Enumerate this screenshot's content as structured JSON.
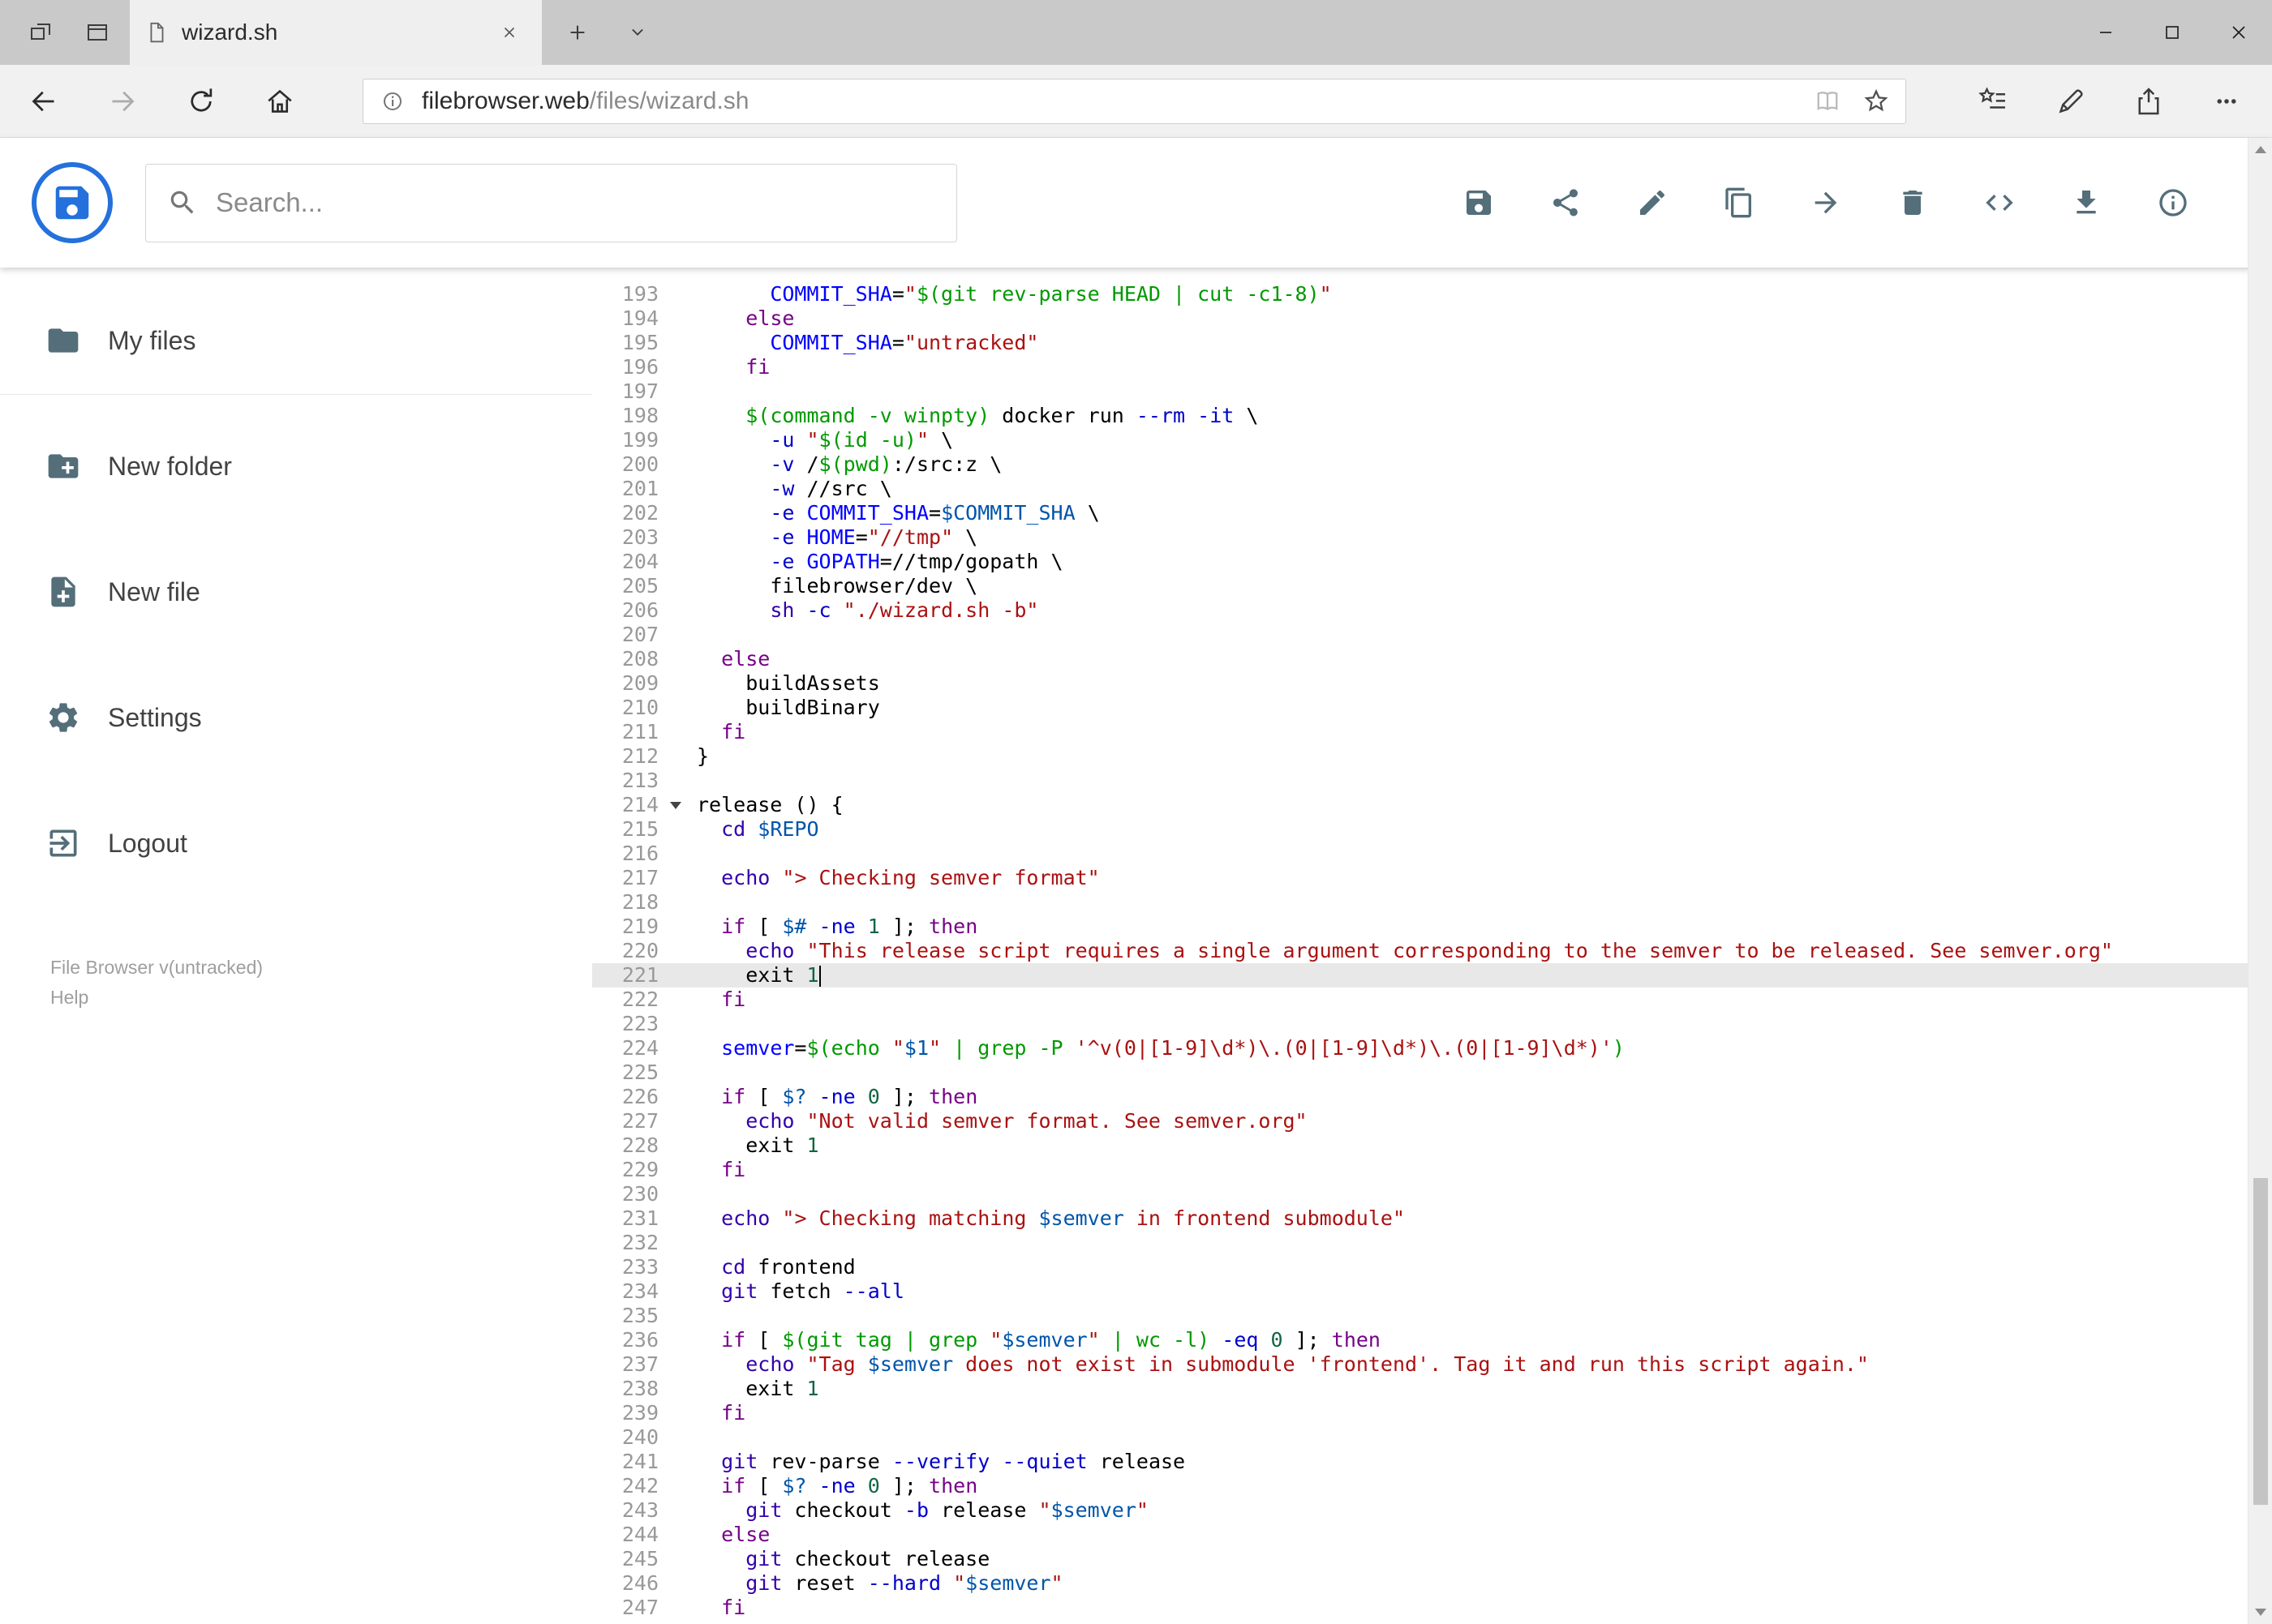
{
  "browser": {
    "tab_title": "wizard.sh",
    "url_host": "filebrowser.web",
    "url_path": "/files/wizard.sh"
  },
  "search": {
    "placeholder": "Search..."
  },
  "header": {
    "actions": [
      "save",
      "share",
      "edit",
      "copy",
      "move",
      "delete",
      "code",
      "download",
      "info"
    ]
  },
  "sidebar": {
    "items": [
      {
        "icon": "folder-icon",
        "label": "My files"
      },
      {
        "icon": "new-folder-icon",
        "label": "New folder"
      },
      {
        "icon": "new-file-icon",
        "label": "New file"
      },
      {
        "icon": "settings-icon",
        "label": "Settings"
      },
      {
        "icon": "logout-icon",
        "label": "Logout"
      }
    ],
    "footer": {
      "version": "File Browser v(untracked)",
      "help": "Help"
    }
  },
  "icons": {
    "tabbar": [
      "set-tabs-aside-icon",
      "tab-preview-icon",
      "page-icon",
      "close-icon",
      "new-tab-icon",
      "tab-list-chevron-icon"
    ],
    "window": [
      "minimize-icon",
      "maximize-icon",
      "close-icon"
    ],
    "navbar": [
      "back-icon",
      "forward-icon",
      "refresh-icon",
      "home-icon",
      "info-icon",
      "reading-view-icon",
      "star-icon",
      "favorites-hub-icon",
      "web-note-pen-icon",
      "share-icon",
      "more-icon"
    ],
    "header": [
      "save-icon",
      "share-icon",
      "edit-icon",
      "copy-icon",
      "move-icon",
      "delete-icon",
      "code-icon",
      "download-icon",
      "info-icon"
    ],
    "sidebar": [
      "folder-icon",
      "new-folder-icon",
      "new-file-icon",
      "settings-icon",
      "logout-icon"
    ]
  },
  "colors": {
    "accent": "#2470dc",
    "app_icon": "#546e7a",
    "active_line_bg": "#e8e8e8",
    "syntax": {
      "keyword": "#770088",
      "builtin": "#3300aa",
      "variable": "#0055aa",
      "def": "#0000ff",
      "string": "#aa1111",
      "quote": "#009900",
      "attribute": "#0000cc",
      "number": "#116644"
    }
  },
  "editor": {
    "first_line": 193,
    "last_line": 247,
    "active_line": 221,
    "cursor_line": 221,
    "fold_marker_line": 214,
    "lines": [
      {
        "no": 193,
        "tokens": [
          [
            "",
            "      "
          ],
          [
            "d",
            "COMMIT_SHA"
          ],
          [
            "",
            "="
          ],
          [
            "s",
            "\""
          ],
          [
            "q",
            "$(git rev-parse HEAD | cut -c1-8)"
          ],
          [
            "s",
            "\""
          ]
        ]
      },
      {
        "no": 194,
        "tokens": [
          [
            "",
            "    "
          ],
          [
            "k",
            "else"
          ]
        ]
      },
      {
        "no": 195,
        "tokens": [
          [
            "",
            "      "
          ],
          [
            "d",
            "COMMIT_SHA"
          ],
          [
            "",
            "="
          ],
          [
            "s",
            "\"untracked\""
          ]
        ]
      },
      {
        "no": 196,
        "tokens": [
          [
            "",
            "    "
          ],
          [
            "k",
            "fi"
          ]
        ]
      },
      {
        "no": 197,
        "tokens": []
      },
      {
        "no": 198,
        "tokens": [
          [
            "",
            "    "
          ],
          [
            "q",
            "$(command -v winpty)"
          ],
          [
            "",
            " docker run "
          ],
          [
            "a",
            "--rm"
          ],
          [
            "",
            " "
          ],
          [
            "a",
            "-it"
          ],
          [
            "",
            " \\"
          ]
        ]
      },
      {
        "no": 199,
        "tokens": [
          [
            "",
            "      "
          ],
          [
            "a",
            "-u"
          ],
          [
            "",
            " "
          ],
          [
            "s",
            "\""
          ],
          [
            "q",
            "$(id -u)"
          ],
          [
            "s",
            "\""
          ],
          [
            "",
            " \\"
          ]
        ]
      },
      {
        "no": 200,
        "tokens": [
          [
            "",
            "      "
          ],
          [
            "a",
            "-v"
          ],
          [
            "",
            " /"
          ],
          [
            "q",
            "$(pwd)"
          ],
          [
            "",
            ":/src:z \\"
          ]
        ]
      },
      {
        "no": 201,
        "tokens": [
          [
            "",
            "      "
          ],
          [
            "a",
            "-w"
          ],
          [
            "",
            " //src \\"
          ]
        ]
      },
      {
        "no": 202,
        "tokens": [
          [
            "",
            "      "
          ],
          [
            "a",
            "-e"
          ],
          [
            "",
            " "
          ],
          [
            "d",
            "COMMIT_SHA"
          ],
          [
            "",
            "="
          ],
          [
            "v",
            "$COMMIT_SHA"
          ],
          [
            "",
            " \\"
          ]
        ]
      },
      {
        "no": 203,
        "tokens": [
          [
            "",
            "      "
          ],
          [
            "a",
            "-e"
          ],
          [
            "",
            " "
          ],
          [
            "d",
            "HOME"
          ],
          [
            "",
            "="
          ],
          [
            "s",
            "\"//tmp\""
          ],
          [
            "",
            " \\"
          ]
        ]
      },
      {
        "no": 204,
        "tokens": [
          [
            "",
            "      "
          ],
          [
            "a",
            "-e"
          ],
          [
            "",
            " "
          ],
          [
            "d",
            "GOPATH"
          ],
          [
            "",
            "=//tmp/gopath \\"
          ]
        ]
      },
      {
        "no": 205,
        "tokens": [
          [
            "",
            "      "
          ],
          [
            "",
            "filebrowser/dev \\"
          ]
        ]
      },
      {
        "no": 206,
        "tokens": [
          [
            "",
            "      "
          ],
          [
            "b",
            "sh"
          ],
          [
            "",
            " "
          ],
          [
            "a",
            "-c"
          ],
          [
            "",
            " "
          ],
          [
            "s",
            "\"./wizard.sh -b\""
          ]
        ]
      },
      {
        "no": 207,
        "tokens": []
      },
      {
        "no": 208,
        "tokens": [
          [
            "",
            "  "
          ],
          [
            "k",
            "else"
          ]
        ]
      },
      {
        "no": 209,
        "tokens": [
          [
            "",
            "    "
          ],
          [
            "",
            "buildAssets"
          ]
        ]
      },
      {
        "no": 210,
        "tokens": [
          [
            "",
            "    "
          ],
          [
            "",
            "buildBinary"
          ]
        ]
      },
      {
        "no": 211,
        "tokens": [
          [
            "",
            "  "
          ],
          [
            "k",
            "fi"
          ]
        ]
      },
      {
        "no": 212,
        "tokens": [
          [
            "",
            "}"
          ]
        ]
      },
      {
        "no": 213,
        "tokens": []
      },
      {
        "no": 214,
        "tokens": [
          [
            "",
            "release () {"
          ]
        ]
      },
      {
        "no": 215,
        "tokens": [
          [
            "",
            "  "
          ],
          [
            "b",
            "cd"
          ],
          [
            "",
            " "
          ],
          [
            "v",
            "$REPO"
          ]
        ]
      },
      {
        "no": 216,
        "tokens": []
      },
      {
        "no": 217,
        "tokens": [
          [
            "",
            "  "
          ],
          [
            "b",
            "echo"
          ],
          [
            "",
            " "
          ],
          [
            "s",
            "\"> Checking semver format\""
          ]
        ]
      },
      {
        "no": 218,
        "tokens": []
      },
      {
        "no": 219,
        "tokens": [
          [
            "",
            "  "
          ],
          [
            "k",
            "if"
          ],
          [
            "",
            " [ "
          ],
          [
            "v",
            "$#"
          ],
          [
            "",
            " "
          ],
          [
            "a",
            "-ne"
          ],
          [
            "",
            " "
          ],
          [
            "n",
            "1"
          ],
          [
            "",
            " ]; "
          ],
          [
            "k",
            "then"
          ]
        ]
      },
      {
        "no": 220,
        "tokens": [
          [
            "",
            "    "
          ],
          [
            "b",
            "echo"
          ],
          [
            "",
            " "
          ],
          [
            "s",
            "\"This release script requires a single argument corresponding to the semver to be released. See semver.org\""
          ]
        ]
      },
      {
        "no": 221,
        "tokens": [
          [
            "",
            "    "
          ],
          [
            "",
            "exit"
          ],
          [
            "",
            " "
          ],
          [
            "n",
            "1"
          ]
        ]
      },
      {
        "no": 222,
        "tokens": [
          [
            "",
            "  "
          ],
          [
            "k",
            "fi"
          ]
        ]
      },
      {
        "no": 223,
        "tokens": []
      },
      {
        "no": 224,
        "tokens": [
          [
            "",
            "  "
          ],
          [
            "d",
            "semver"
          ],
          [
            "",
            "="
          ],
          [
            "q",
            "$(echo "
          ],
          [
            "s",
            "\""
          ],
          [
            "v",
            "$1"
          ],
          [
            "s",
            "\""
          ],
          [
            "q",
            " | grep -P "
          ],
          [
            "s",
            "'^v(0|[1-9]\\d*)\\.(0|[1-9]\\d*)\\.(0|[1-9]\\d*)'"
          ],
          [
            "q",
            ")"
          ]
        ]
      },
      {
        "no": 225,
        "tokens": []
      },
      {
        "no": 226,
        "tokens": [
          [
            "",
            "  "
          ],
          [
            "k",
            "if"
          ],
          [
            "",
            " [ "
          ],
          [
            "v",
            "$?"
          ],
          [
            "",
            " "
          ],
          [
            "a",
            "-ne"
          ],
          [
            "",
            " "
          ],
          [
            "n",
            "0"
          ],
          [
            "",
            " ]; "
          ],
          [
            "k",
            "then"
          ]
        ]
      },
      {
        "no": 227,
        "tokens": [
          [
            "",
            "    "
          ],
          [
            "b",
            "echo"
          ],
          [
            "",
            " "
          ],
          [
            "s",
            "\"Not valid semver format. See semver.org\""
          ]
        ]
      },
      {
        "no": 228,
        "tokens": [
          [
            "",
            "    "
          ],
          [
            "",
            "exit"
          ],
          [
            "",
            " "
          ],
          [
            "n",
            "1"
          ]
        ]
      },
      {
        "no": 229,
        "tokens": [
          [
            "",
            "  "
          ],
          [
            "k",
            "fi"
          ]
        ]
      },
      {
        "no": 230,
        "tokens": []
      },
      {
        "no": 231,
        "tokens": [
          [
            "",
            "  "
          ],
          [
            "b",
            "echo"
          ],
          [
            "",
            " "
          ],
          [
            "s",
            "\"> Checking matching "
          ],
          [
            "v",
            "$semver"
          ],
          [
            "s",
            " in frontend submodule\""
          ]
        ]
      },
      {
        "no": 232,
        "tokens": []
      },
      {
        "no": 233,
        "tokens": [
          [
            "",
            "  "
          ],
          [
            "b",
            "cd"
          ],
          [
            "",
            " frontend"
          ]
        ]
      },
      {
        "no": 234,
        "tokens": [
          [
            "",
            "  "
          ],
          [
            "b",
            "git"
          ],
          [
            "",
            " fetch "
          ],
          [
            "a",
            "--all"
          ]
        ]
      },
      {
        "no": 235,
        "tokens": []
      },
      {
        "no": 236,
        "tokens": [
          [
            "",
            "  "
          ],
          [
            "k",
            "if"
          ],
          [
            "",
            " [ "
          ],
          [
            "q",
            "$(git tag | grep "
          ],
          [
            "s",
            "\""
          ],
          [
            "v",
            "$semver"
          ],
          [
            "s",
            "\""
          ],
          [
            "q",
            " | wc -l)"
          ],
          [
            "",
            " "
          ],
          [
            "a",
            "-eq"
          ],
          [
            "",
            " "
          ],
          [
            "n",
            "0"
          ],
          [
            "",
            " ]; "
          ],
          [
            "k",
            "then"
          ]
        ]
      },
      {
        "no": 237,
        "tokens": [
          [
            "",
            "    "
          ],
          [
            "b",
            "echo"
          ],
          [
            "",
            " "
          ],
          [
            "s",
            "\"Tag "
          ],
          [
            "v",
            "$semver"
          ],
          [
            "s",
            " does not exist in submodule 'frontend'. Tag it and run this script again.\""
          ]
        ]
      },
      {
        "no": 238,
        "tokens": [
          [
            "",
            "    "
          ],
          [
            "",
            "exit"
          ],
          [
            "",
            " "
          ],
          [
            "n",
            "1"
          ]
        ]
      },
      {
        "no": 239,
        "tokens": [
          [
            "",
            "  "
          ],
          [
            "k",
            "fi"
          ]
        ]
      },
      {
        "no": 240,
        "tokens": []
      },
      {
        "no": 241,
        "tokens": [
          [
            "",
            "  "
          ],
          [
            "b",
            "git"
          ],
          [
            "",
            " rev-parse "
          ],
          [
            "a",
            "--verify"
          ],
          [
            "",
            " "
          ],
          [
            "a",
            "--quiet"
          ],
          [
            "",
            " release"
          ]
        ]
      },
      {
        "no": 242,
        "tokens": [
          [
            "",
            "  "
          ],
          [
            "k",
            "if"
          ],
          [
            "",
            " [ "
          ],
          [
            "v",
            "$?"
          ],
          [
            "",
            " "
          ],
          [
            "a",
            "-ne"
          ],
          [
            "",
            " "
          ],
          [
            "n",
            "0"
          ],
          [
            "",
            " ]; "
          ],
          [
            "k",
            "then"
          ]
        ]
      },
      {
        "no": 243,
        "tokens": [
          [
            "",
            "    "
          ],
          [
            "b",
            "git"
          ],
          [
            "",
            " checkout "
          ],
          [
            "a",
            "-b"
          ],
          [
            "",
            " release "
          ],
          [
            "s",
            "\""
          ],
          [
            "v",
            "$semver"
          ],
          [
            "s",
            "\""
          ]
        ]
      },
      {
        "no": 244,
        "tokens": [
          [
            "",
            "  "
          ],
          [
            "k",
            "else"
          ]
        ]
      },
      {
        "no": 245,
        "tokens": [
          [
            "",
            "    "
          ],
          [
            "b",
            "git"
          ],
          [
            "",
            " checkout release"
          ]
        ]
      },
      {
        "no": 246,
        "tokens": [
          [
            "",
            "    "
          ],
          [
            "b",
            "git"
          ],
          [
            "",
            " reset "
          ],
          [
            "a",
            "--hard"
          ],
          [
            "",
            " "
          ],
          [
            "s",
            "\""
          ],
          [
            "v",
            "$semver"
          ],
          [
            "s",
            "\""
          ]
        ]
      },
      {
        "no": 247,
        "tokens": [
          [
            "",
            "  "
          ],
          [
            "k",
            "fi"
          ]
        ]
      }
    ]
  }
}
